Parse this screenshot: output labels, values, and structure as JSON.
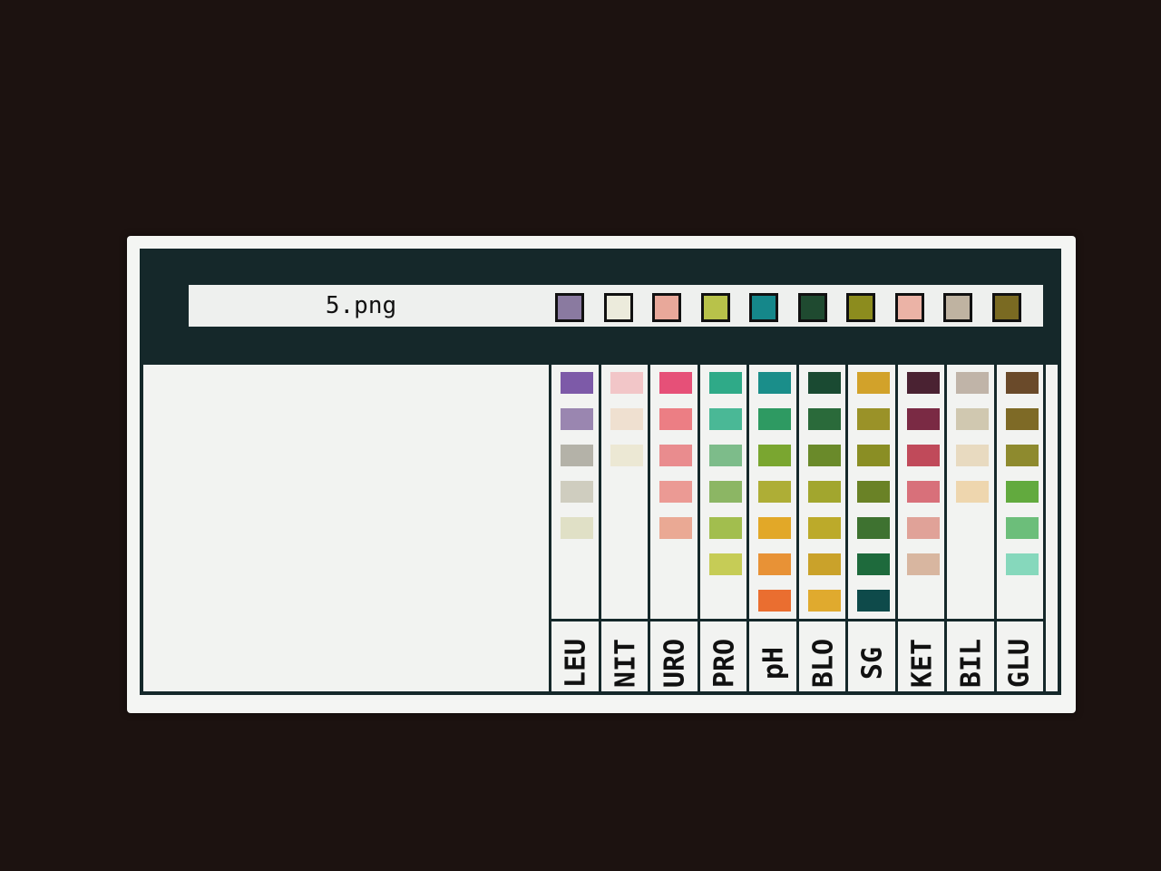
{
  "filename": "5.png",
  "result_swatches": [
    "#8a7aa0",
    "#ecebdc",
    "#e8a89a",
    "#b8c24a",
    "#15878a",
    "#1f4a30",
    "#8c8c1e",
    "#ebb3a6",
    "#bfb3a1",
    "#7a6a22"
  ],
  "columns": [
    {
      "label": "LEU",
      "swatches": [
        "#7d5aa8",
        "#9a86b0",
        "#b4b2a8",
        "#cfcdbf",
        "#e0e0c6"
      ]
    },
    {
      "label": "NIT",
      "swatches": [
        "#f2c6c8",
        "#efe0d0",
        "#ece8d4"
      ]
    },
    {
      "label": "URO",
      "swatches": [
        "#e65078",
        "#ec7e84",
        "#e98c8e",
        "#eb9a94",
        "#eaa994"
      ]
    },
    {
      "label": "PRO",
      "swatches": [
        "#2faa88",
        "#4ab896",
        "#7dbc8a",
        "#8cb664",
        "#a2be4e",
        "#c6cc56"
      ]
    },
    {
      "label": "pH",
      "swatches": [
        "#1a8e8a",
        "#2e9a62",
        "#7aa630",
        "#aeae36",
        "#e2a828",
        "#e89236",
        "#ea6e30"
      ]
    },
    {
      "label": "BLO",
      "swatches": [
        "#1a4a32",
        "#2a6a3a",
        "#6a8a2a",
        "#a2a62e",
        "#bcaa2a",
        "#caa22a",
        "#e0aa2e"
      ]
    },
    {
      "label": "SG",
      "swatches": [
        "#d2a22a",
        "#9a9228",
        "#8a8e24",
        "#6a8226",
        "#3e7230",
        "#1e6a3c",
        "#0e4a4a"
      ]
    },
    {
      "label": "KET",
      "swatches": [
        "#4a2232",
        "#7a2a44",
        "#c04a5a",
        "#d8707a",
        "#e0a298",
        "#d8b6a0"
      ]
    },
    {
      "label": "BIL",
      "swatches": [
        "#c0b4a8",
        "#d0c8b0",
        "#e8dac0",
        "#eed6ae"
      ]
    },
    {
      "label": "GLU",
      "swatches": [
        "#6a4a2a",
        "#7e6a26",
        "#8e8a2e",
        "#62aa3e",
        "#6cbe7a",
        "#86d8bc"
      ]
    }
  ]
}
